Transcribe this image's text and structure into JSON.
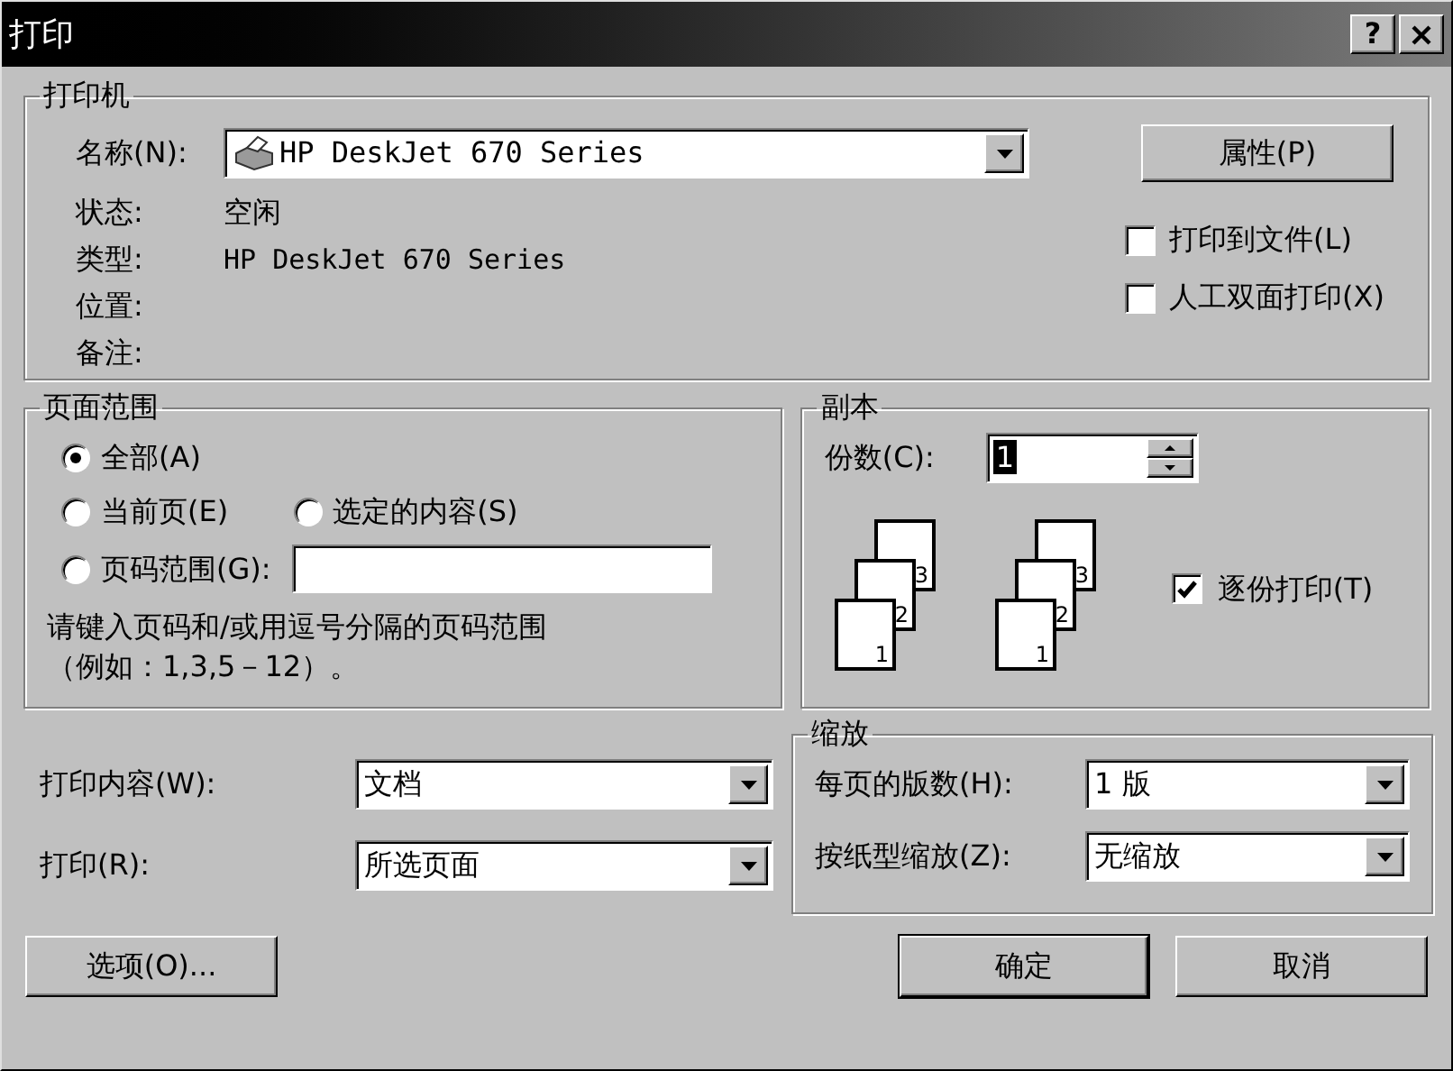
{
  "window": {
    "title": "打印",
    "help_button": "?"
  },
  "printer": {
    "group_title": "打印机",
    "name_label": "名称(N):",
    "name_value": "HP DeskJet 670 Series",
    "properties_button": "属性(P)",
    "info": [
      {
        "label": "状态:",
        "value": "空闲"
      },
      {
        "label": "类型:",
        "value": "HP DeskJet 670 Series"
      },
      {
        "label": "位置:"
      },
      {
        "label": "备注:"
      }
    ],
    "options": [
      {
        "label": "打印到文件(L)",
        "checked": false
      },
      {
        "label": "人工双面打印(X)",
        "checked": false
      }
    ]
  },
  "page_range": {
    "group_title": "页面范围",
    "options": [
      {
        "label": "全部(A)",
        "selected": true
      },
      {
        "label": "当前页(E)",
        "selected": false
      },
      {
        "label": "选定的内容(S)",
        "selected": false
      },
      {
        "label": "页码范围(G):",
        "selected": false
      }
    ],
    "hint_lines": [
      "请键入页码和/或用逗号分隔的页码范围",
      "（例如：1,3,5－12）。"
    ]
  },
  "copies": {
    "group_title": "副本",
    "count_label": "份数(C):",
    "count_value": "1",
    "stacks": [
      {
        "pages": [
          "1",
          "2",
          "3"
        ]
      },
      {
        "pages": [
          "1",
          "2",
          "3"
        ]
      }
    ],
    "collate": {
      "label": "逐份打印(T)",
      "checked": true
    }
  },
  "print_what": {
    "label": "打印内容(W):",
    "value": "文档"
  },
  "print": {
    "label": "打印(R):",
    "value": "所选页面"
  },
  "zoom": {
    "group_title": "缩放",
    "rows": [
      {
        "label": "每页的版数(H):",
        "value": "1 版"
      },
      {
        "label": "按纸型缩放(Z):",
        "value": "无缩放"
      }
    ]
  },
  "buttons": {
    "options": "选项(O)...",
    "ok": "确定",
    "cancel": "取消"
  }
}
